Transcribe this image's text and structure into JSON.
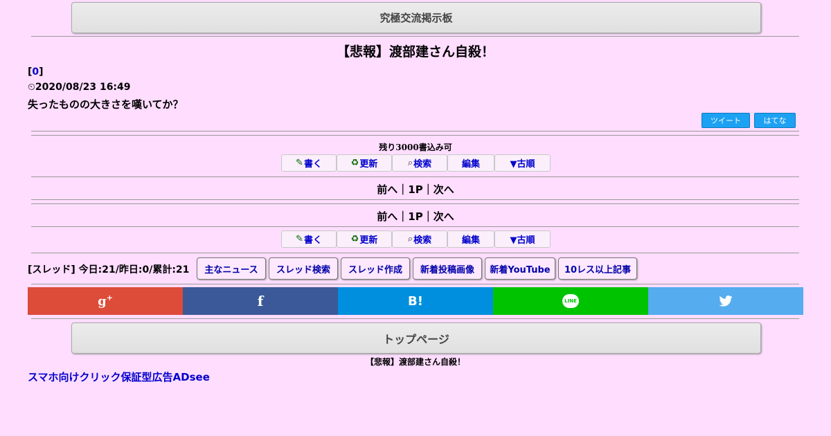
{
  "header": {
    "board_title": "究極交流掲示板"
  },
  "thread": {
    "title": "【悲報】渡部建さん自殺！",
    "post_number": "0",
    "timestamp": "2020/08/23 16:49",
    "body": "失ったものの大きさを嘆いてか？"
  },
  "share_buttons": {
    "tweet": "ツイート",
    "hatena": "はてな"
  },
  "remaining": "残り3000書込み可",
  "toolbar": {
    "write": "書く",
    "refresh": "更新",
    "search": "検索",
    "edit": "編集",
    "oldest": "▼古順"
  },
  "pager": {
    "prev": "前へ",
    "page": "1P",
    "next": "次へ"
  },
  "stats": "[スレッド] 今日:21/昨日:0/累計:21",
  "nav_links": [
    "主なニュース",
    "スレッド検索",
    "スレッド作成",
    "新着投稿画像",
    "新着YouTube",
    "10レス以上記事"
  ],
  "sns": {
    "google": "g+",
    "facebook": "f",
    "hatebu": "B!",
    "line": "LINE",
    "twitter": "twitter",
    "colors": {
      "google": "#dd4b39",
      "facebook": "#3b5998",
      "hatebu": "#008fde",
      "line": "#00c300",
      "twitter": "#55acee"
    }
  },
  "footer": {
    "top_page": "トップページ",
    "thread_title": "【悲報】渡部建さん自殺！",
    "ad_link": "スマホ向けクリック保証型広告ADsee"
  }
}
